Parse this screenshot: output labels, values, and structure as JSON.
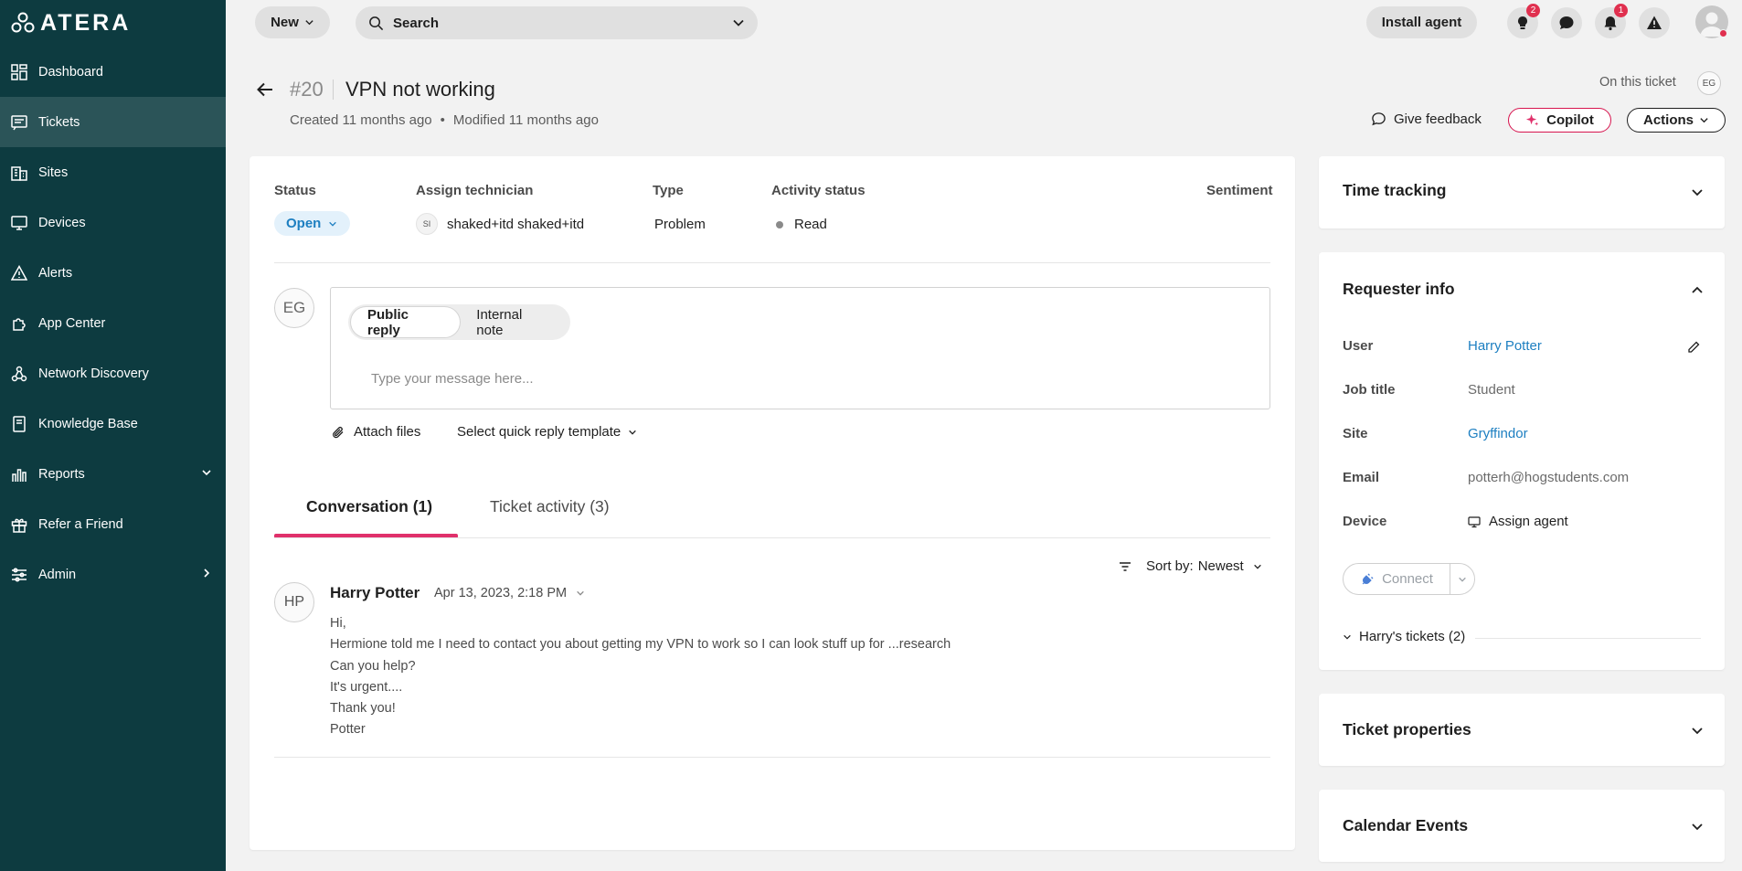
{
  "brand": {
    "name": "ATERA"
  },
  "sidebar": {
    "items": [
      {
        "label": "Dashboard",
        "icon": "dashboard-icon"
      },
      {
        "label": "Tickets",
        "icon": "tickets-icon",
        "active": true
      },
      {
        "label": "Sites",
        "icon": "sites-icon"
      },
      {
        "label": "Devices",
        "icon": "devices-icon"
      },
      {
        "label": "Alerts",
        "icon": "alerts-icon"
      },
      {
        "label": "App Center",
        "icon": "app-center-icon"
      },
      {
        "label": "Network Discovery",
        "icon": "network-discovery-icon"
      },
      {
        "label": "Knowledge Base",
        "icon": "knowledge-base-icon"
      },
      {
        "label": "Reports",
        "icon": "reports-icon",
        "chevron": "down"
      },
      {
        "label": "Refer a Friend",
        "icon": "gift-icon"
      },
      {
        "label": "Admin",
        "icon": "admin-icon",
        "chevron": "right"
      }
    ]
  },
  "topbar": {
    "new_label": "New",
    "search_label": "Search",
    "install_label": "Install agent",
    "tips_badge": "2",
    "notifications_badge": "1"
  },
  "ticket": {
    "number": "#20",
    "title": "VPN not working",
    "created": "Created 11 months ago",
    "dot": "•",
    "modified": "Modified 11 months ago",
    "on_this_ticket": "On this ticket",
    "viewer_initials": "EG"
  },
  "header_actions": {
    "feedback": "Give feedback",
    "copilot": "Copilot",
    "actions": "Actions"
  },
  "fields": {
    "status_label": "Status",
    "status_value": "Open",
    "assign_label": "Assign technician",
    "assign_initials": "SI",
    "assign_value": "shaked+itd shaked+itd",
    "type_label": "Type",
    "type_value": "Problem",
    "activity_label": "Activity status",
    "activity_value": "Read",
    "sentiment_label": "Sentiment"
  },
  "reply": {
    "author_initials": "EG",
    "tab_public": "Public reply",
    "tab_internal": "Internal note",
    "placeholder": "Type your message here...",
    "attach": "Attach files",
    "quick_template": "Select quick reply template"
  },
  "tabs": {
    "conversation": "Conversation (1)",
    "activity": "Ticket activity (3)"
  },
  "sort": {
    "label": "Sort by:",
    "value": "Newest"
  },
  "message": {
    "initials": "HP",
    "author": "Harry Potter",
    "time": "Apr 13, 2023, 2:18 PM",
    "lines": [
      "Hi,",
      "Hermione told me I need to contact you about getting my VPN to work so I can look stuff up for ...research",
      "Can you help?",
      "It's urgent....",
      "Thank you!",
      "Potter"
    ]
  },
  "panels": {
    "time_tracking": "Time tracking",
    "requester_info": "Requester info",
    "ticket_properties": "Ticket properties",
    "calendar_events": "Calendar Events"
  },
  "requester": {
    "user_label": "User",
    "user_value": "Harry Potter",
    "job_label": "Job title",
    "job_value": "Student",
    "site_label": "Site",
    "site_value": "Gryffindor",
    "email_label": "Email",
    "email_value": "potterh@hogstudents.com",
    "device_label": "Device",
    "device_value": "Assign agent",
    "connect": "Connect",
    "tickets": "Harry's tickets (2)"
  },
  "colors": {
    "sidebar_bg": "#0d3b40",
    "accent_pink": "#e0306b",
    "link_blue": "#1d7fc1"
  }
}
